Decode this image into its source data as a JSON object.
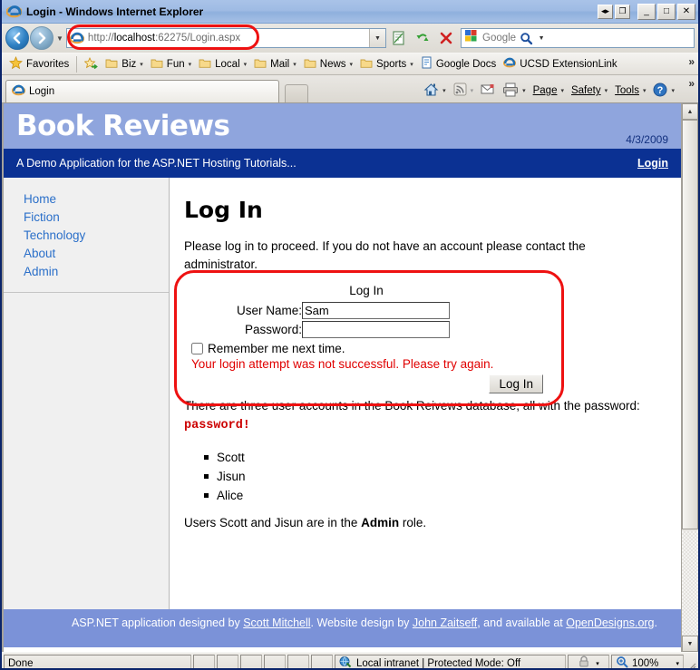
{
  "window": {
    "title": "Login - Windows Internet Explorer",
    "buttons": {
      "restore_small": "◂▸",
      "maximize_small": "❐",
      "minimize": "_",
      "maximize": "□",
      "close": "✕"
    }
  },
  "navbar": {
    "back_label": "◀",
    "forward_label": "▶",
    "recent_caret": "▼",
    "address_icon": "ie-page-icon",
    "address_value": "http://localhost:62275/Login.aspx",
    "address_scheme": "http://",
    "address_host": "localhost",
    "address_rest": ":62275/Login.aspx",
    "address_dropdown_caret": "▼",
    "compat_view_icon": "compatibility-view-icon",
    "refresh_icon": "refresh-icon",
    "stop_icon": "stop-icon",
    "search_provider": "Google",
    "search_placeholder": "Google",
    "search_caret": "▼"
  },
  "favorites_bar": {
    "favorites_label": "Favorites",
    "add_icon": "add-to-favorites-icon",
    "items": [
      {
        "label": "Biz",
        "icon": "folder-icon",
        "caret": "▾"
      },
      {
        "label": "Fun",
        "icon": "folder-icon",
        "caret": "▾"
      },
      {
        "label": "Local",
        "icon": "folder-icon",
        "caret": "▾"
      },
      {
        "label": "Mail",
        "icon": "folder-icon",
        "caret": "▾"
      },
      {
        "label": "News",
        "icon": "folder-icon",
        "caret": "▾"
      },
      {
        "label": "Sports",
        "icon": "folder-icon",
        "caret": "▾"
      },
      {
        "label": "Google Docs",
        "icon": "document-icon",
        "caret": ""
      },
      {
        "label": "UCSD ExtensionLink",
        "icon": "ie-page-icon",
        "caret": ""
      }
    ],
    "overflow": "»"
  },
  "tabbar": {
    "active_tab": "Login",
    "new_tab_label": "",
    "commands": [
      {
        "label": "",
        "icon": "home-icon",
        "caret": "▾"
      },
      {
        "label": "",
        "icon": "feeds-icon",
        "caret": "▾"
      },
      {
        "label": "",
        "icon": "mail-icon",
        "caret": ""
      },
      {
        "label": "",
        "icon": "print-icon",
        "caret": "▾"
      },
      {
        "label": "Page",
        "icon": "",
        "caret": "▾"
      },
      {
        "label": "Safety",
        "icon": "",
        "caret": "▾"
      },
      {
        "label": "Tools",
        "icon": "",
        "caret": "▾"
      },
      {
        "label": "",
        "icon": "help-icon",
        "caret": "▾"
      }
    ],
    "overflow": "»"
  },
  "site": {
    "title": "Book Reviews",
    "date": "4/3/2009",
    "tagline": "A Demo Application for the ASP.NET Hosting Tutorials...",
    "login_link": "Login",
    "nav": [
      {
        "label": "Home"
      },
      {
        "label": "Fiction"
      },
      {
        "label": "Technology"
      },
      {
        "label": "About"
      },
      {
        "label": "Admin"
      }
    ],
    "footer": {
      "text_1": "ASP.NET application designed by ",
      "link_1": "Scott Mitchell",
      "text_2": ". Website design by ",
      "link_2": "John Zaitseff",
      "text_3": ", and available at ",
      "link_3": "OpenDesigns.org",
      "text_4": "."
    }
  },
  "content": {
    "heading": "Log In",
    "intro": "Please log in to proceed. If you do not have an account please contact the administrator.",
    "login_form": {
      "title": "Log In",
      "username_label": "User Name:",
      "username_value": "Sam",
      "password_label": "Password:",
      "password_value": "",
      "remember_label": "Remember me next time.",
      "remember_checked": false,
      "error_message": "Your login attempt was not successful. Please try again.",
      "submit_label": "Log In"
    },
    "accounts_intro_1": "There are three user accounts in the Book Reivews database, all with the password: ",
    "accounts_password": "password!",
    "accounts": [
      "Scott",
      "Jisun",
      "Alice"
    ],
    "roles_text_1": "Users Scott and Jisun are in the ",
    "roles_bold": "Admin",
    "roles_text_2": " role."
  },
  "scrollbar": {
    "up_arrow": "▲",
    "down_arrow": "▼"
  },
  "statusbar": {
    "status": "Done",
    "zone": "Local intranet | Protected Mode: Off",
    "zone_icon": "globe-icon",
    "protected_icon": "lock-icon",
    "protected_caret": "▾",
    "zoom_icon": "zoom-icon",
    "zoom_level": "100%",
    "zoom_caret": "▾"
  },
  "colors": {
    "header_light_blue": "#8fa5dd",
    "header_dark_blue": "#0b3193",
    "footer_blue": "#7b92d8",
    "link_blue": "#2a6fc9",
    "error_red": "#e00000",
    "annotation_red": "#ee1111",
    "sidebar_gray": "#f0f0f0"
  }
}
